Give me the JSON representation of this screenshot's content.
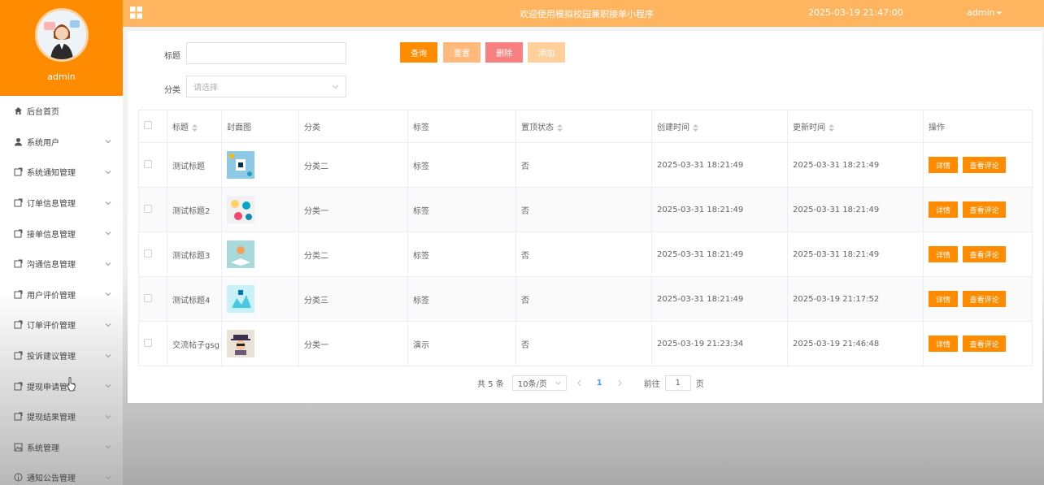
{
  "sidebar": {
    "user": "admin",
    "items": [
      {
        "label": "后台首页",
        "icon": "home-icon",
        "expandable": false
      },
      {
        "label": "系统用户",
        "icon": "user-icon",
        "expandable": true
      },
      {
        "label": "系统通知管理",
        "icon": "doc-icon",
        "expandable": true
      },
      {
        "label": "订单信息管理",
        "icon": "doc-icon",
        "expandable": true
      },
      {
        "label": "接单信息管理",
        "icon": "doc-icon",
        "expandable": true
      },
      {
        "label": "沟通信息管理",
        "icon": "doc-icon",
        "expandable": true
      },
      {
        "label": "用户评价管理",
        "icon": "doc-icon",
        "expandable": true
      },
      {
        "label": "订单评价管理",
        "icon": "doc-icon",
        "expandable": true
      },
      {
        "label": "投诉建议管理",
        "icon": "doc-icon",
        "expandable": true
      },
      {
        "label": "提现申请管理",
        "icon": "doc-icon",
        "expandable": true
      },
      {
        "label": "提现结果管理",
        "icon": "doc-icon",
        "expandable": true
      },
      {
        "label": "系统管理",
        "icon": "image-icon",
        "expandable": true
      },
      {
        "label": "通知公告管理",
        "icon": "info-icon",
        "expandable": true
      }
    ]
  },
  "header": {
    "title": "欢迎使用模拟校园兼职接单小程序",
    "datetime": "2025-03-19 21:47:00",
    "user": "admin"
  },
  "search": {
    "title_label": "标题",
    "title_value": "",
    "category_label": "分类",
    "category_placeholder": "请选择",
    "buttons": {
      "query": "查询",
      "reset": "重置",
      "delete": "删除",
      "add": "添加"
    }
  },
  "colors": {
    "accent": "#ff8c00",
    "header": "#ffb560",
    "reset_btn": "#ffb97a",
    "delete_btn": "#f98080",
    "add_btn": "#ffd09b"
  },
  "table": {
    "headers": {
      "title": "标题",
      "cover": "封面图",
      "category": "分类",
      "tag": "标签",
      "pinned": "置顶状态",
      "created": "创建时间",
      "updated": "更新时间",
      "actions": "操作"
    },
    "action_labels": {
      "detail": "详情",
      "comments": "查看评论"
    },
    "rows": [
      {
        "title": "测试标题",
        "category": "分类二",
        "tag": "标签",
        "pinned": "否",
        "created": "2025-03-31 18:21:49",
        "updated": "2025-03-31 18:21:49"
      },
      {
        "title": "测试标题2",
        "category": "分类一",
        "tag": "标签",
        "pinned": "否",
        "created": "2025-03-31 18:21:49",
        "updated": "2025-03-31 18:21:49"
      },
      {
        "title": "测试标题3",
        "category": "分类二",
        "tag": "标签",
        "pinned": "否",
        "created": "2025-03-31 18:21:49",
        "updated": "2025-03-31 18:21:49"
      },
      {
        "title": "测试标题4",
        "category": "分类三",
        "tag": "标签",
        "pinned": "否",
        "created": "2025-03-31 18:21:49",
        "updated": "2025-03-19 21:17:52"
      },
      {
        "title": "交流帖子gsg",
        "category": "分类一",
        "tag": "演示",
        "pinned": "否",
        "created": "2025-03-19 21:23:34",
        "updated": "2025-03-19 21:46:48"
      }
    ]
  },
  "pagination": {
    "total": "共 5 条",
    "page_size": "10条/页",
    "current_page": "1",
    "goto_label": "前往",
    "goto_value": "1",
    "page_suffix": "页"
  }
}
